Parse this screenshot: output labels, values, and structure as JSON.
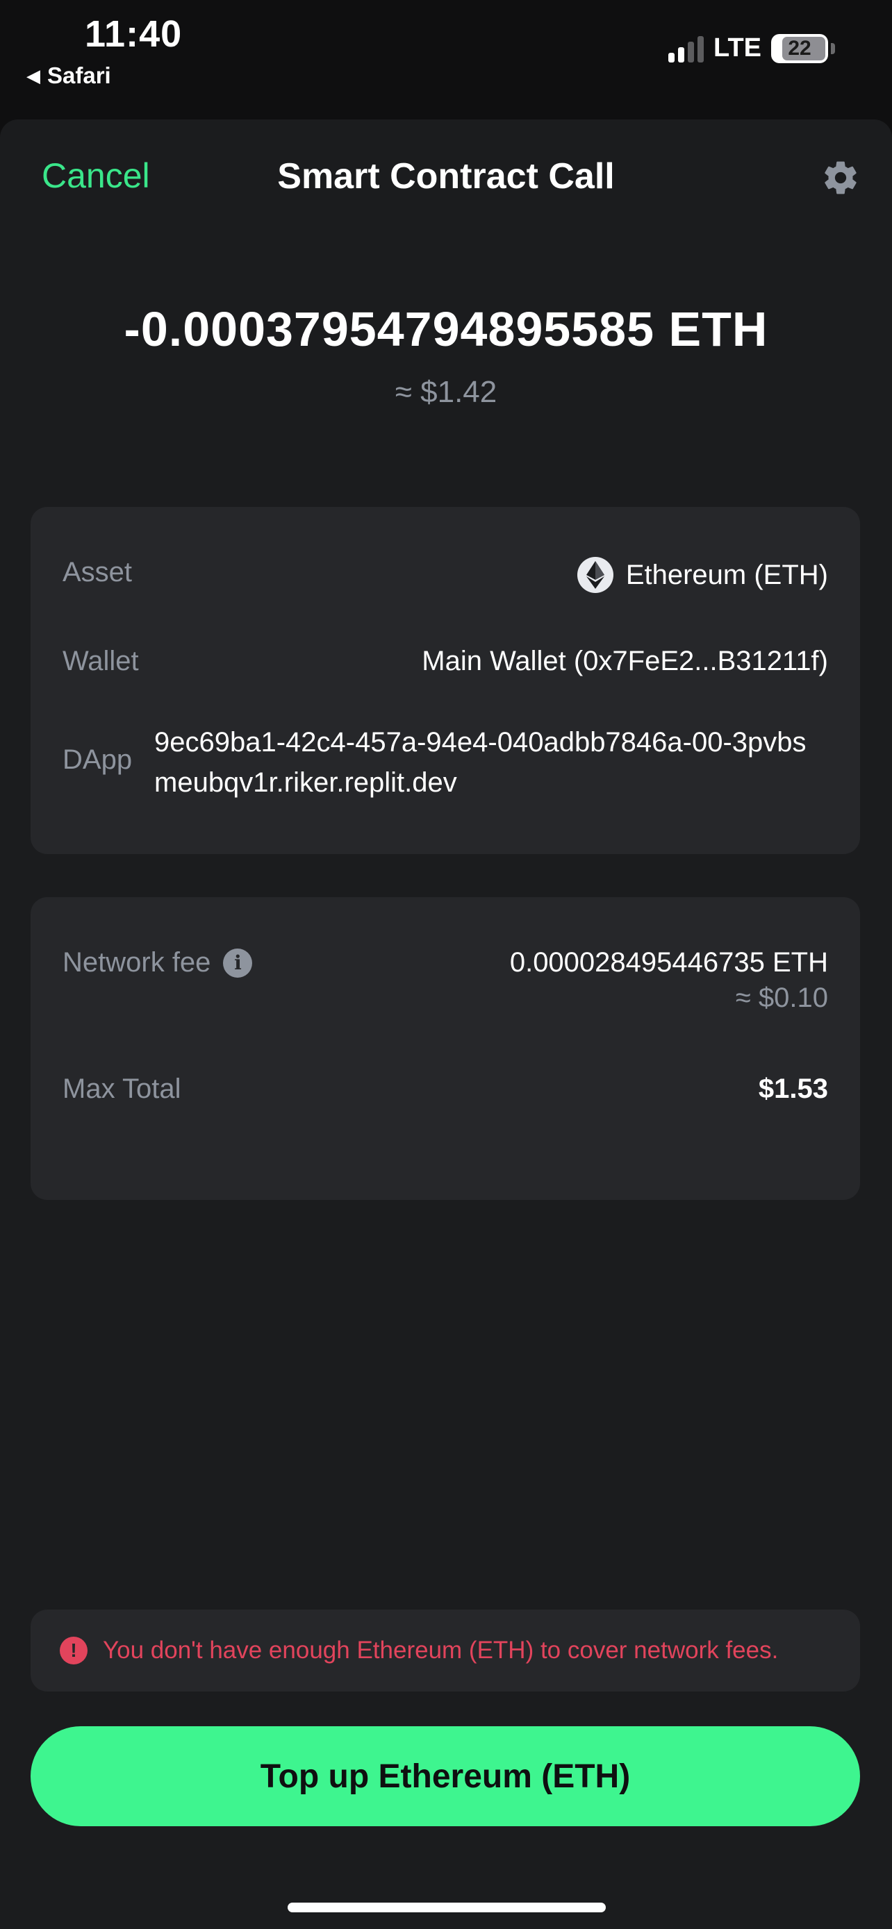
{
  "status_bar": {
    "time": "11:40",
    "back_app": "Safari",
    "network": "LTE",
    "battery": "22"
  },
  "nav": {
    "cancel_label": "Cancel",
    "title": "Smart Contract Call"
  },
  "amount": {
    "value": "-0.00037954794895585 ETH",
    "usd": "≈ $1.42"
  },
  "details": {
    "asset_label": "Asset",
    "asset_value": "Ethereum (ETH)",
    "wallet_label": "Wallet",
    "wallet_value": "Main Wallet (0x7FeE2...B31211f)",
    "dapp_label": "DApp",
    "dapp_value": "9ec69ba1-42c4-457a-94e4-040adbb7846a-00-3pvbsmeubqv1r.riker.replit.dev"
  },
  "fees": {
    "network_fee_label": "Network fee",
    "network_fee_value": "0.000028495446735 ETH",
    "network_fee_usd": "≈ $0.10",
    "max_total_label": "Max Total",
    "max_total_value": "$1.53"
  },
  "warning": {
    "text": "You don't have enough Ethereum (ETH) to cover network fees."
  },
  "cta": {
    "label": "Top up Ethereum (ETH)"
  },
  "colors": {
    "accent_green": "#3ef58f",
    "cancel_green": "#3ae68a",
    "error_red": "#e2445c",
    "sheet_bg": "#1b1c1e",
    "card_bg": "#26272a"
  },
  "icons": [
    "back-triangle-icon",
    "signal-icon",
    "battery-icon",
    "gear-icon",
    "ethereum-icon",
    "info-icon",
    "error-icon"
  ]
}
